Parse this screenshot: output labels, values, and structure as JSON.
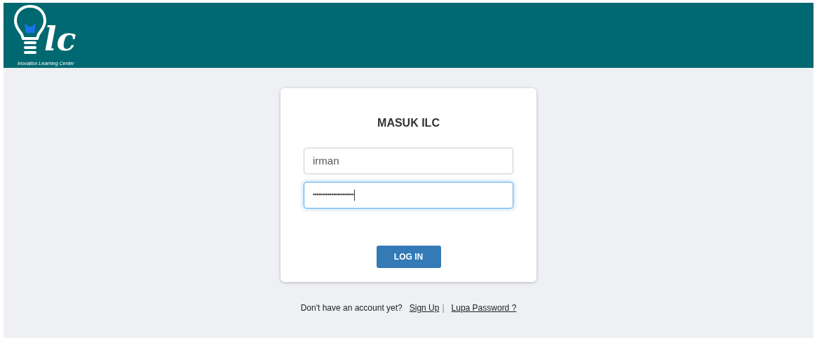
{
  "header": {
    "logo": {
      "letters": "lc",
      "tagline": "Inovation Learning Center"
    }
  },
  "login": {
    "title": "MASUK ILC",
    "fields": [
      {
        "kind": "text",
        "value": "irman",
        "focused": false
      },
      {
        "kind": "password",
        "value": "••••••••••••••••••••••",
        "focused": true
      }
    ],
    "button": "LOG IN"
  },
  "footer": {
    "prompt": "Don't have an account yet?",
    "links": [
      {
        "label": "Sign Up"
      },
      {
        "label": "Lupa Password ?"
      }
    ],
    "separator": "|"
  }
}
